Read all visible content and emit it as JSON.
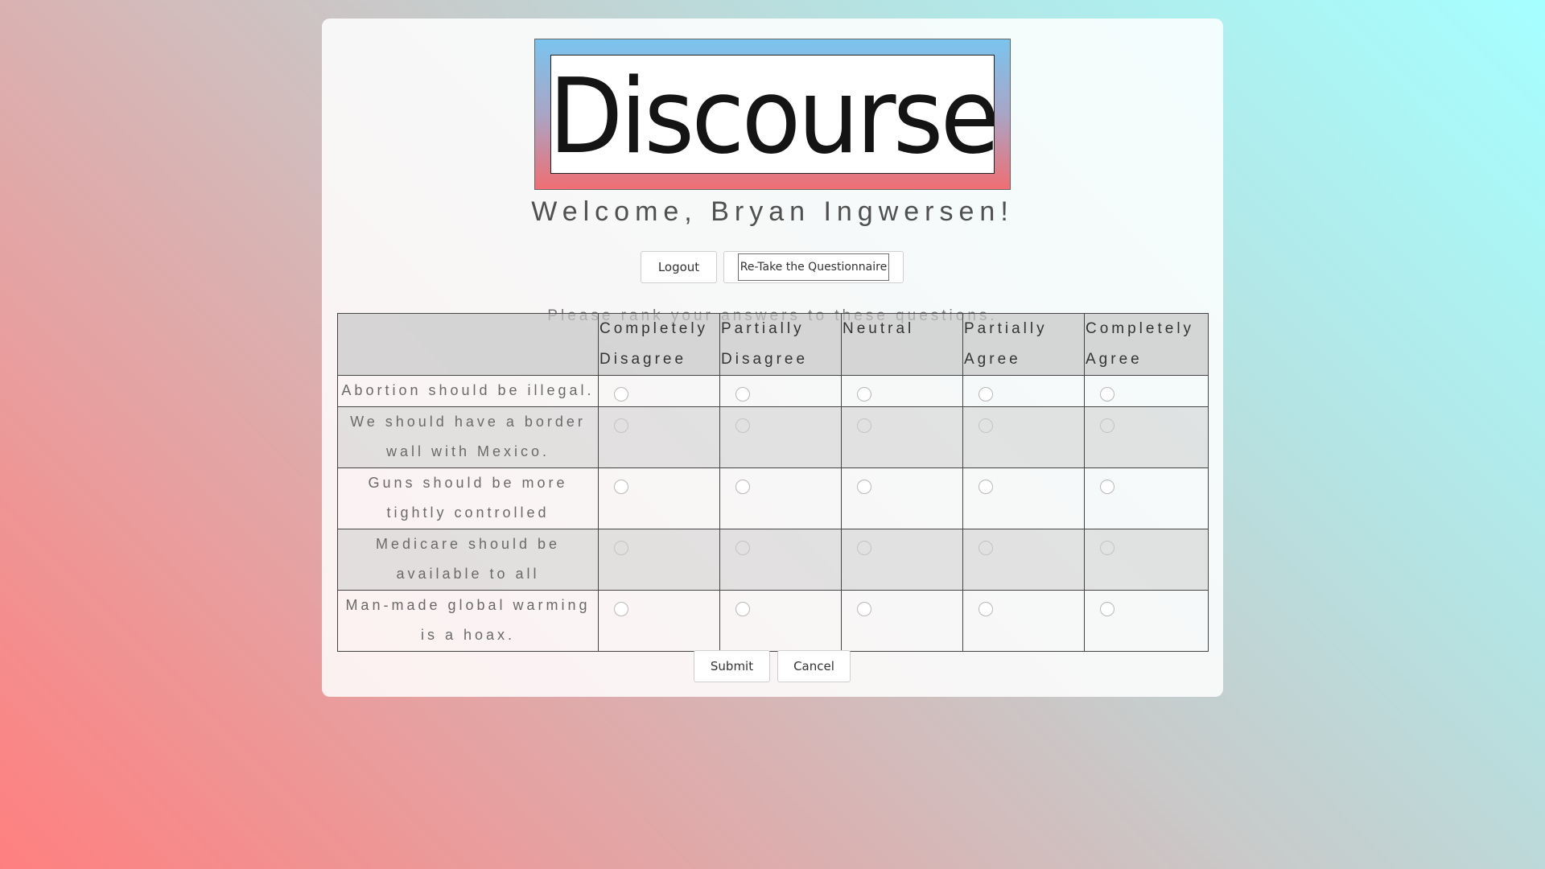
{
  "logo": {
    "text": "Discourse"
  },
  "header": {
    "welcome": "Welcome, Bryan Ingwersen!"
  },
  "buttons": {
    "logout": "Logout",
    "retake": "Re-Take the Questionnaire",
    "submit": "Submit",
    "cancel": "Cancel"
  },
  "questionnaire": {
    "instructions": "Please rank your answers to these questions.",
    "columns": [
      "Completely Disagree",
      "Partially Disagree",
      "Neutral",
      "Partially Agree",
      "Completely Agree"
    ],
    "questions": [
      "Abortion should be illegal.",
      "We should have a border wall with Mexico.",
      "Guns should be more tightly controlled",
      "Medicare should be available to all",
      "Man-made global warming is a hoax."
    ]
  }
}
